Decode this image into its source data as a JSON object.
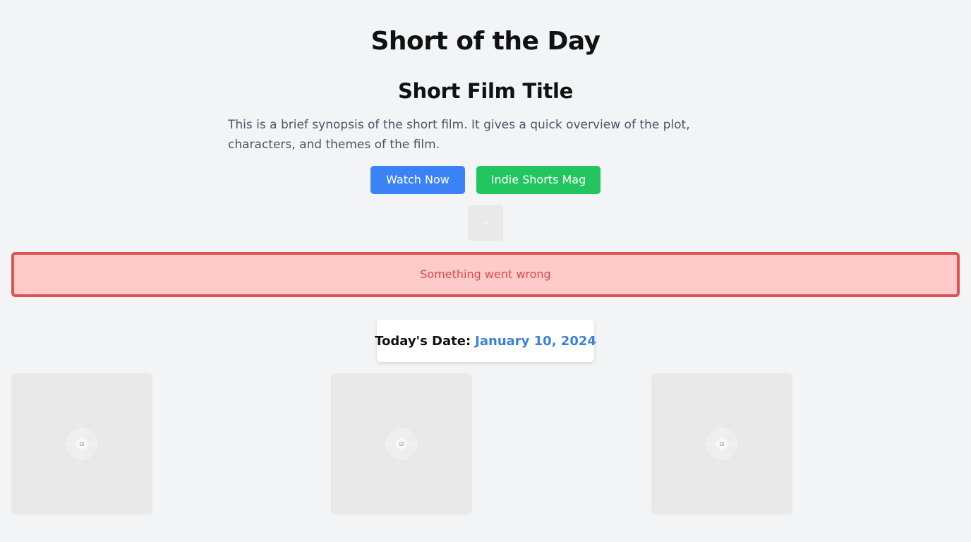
{
  "header": {
    "site_title": "Short of the Day"
  },
  "film": {
    "title": "Short Film Title",
    "synopsis": "This is a brief synopsis of the short film. It gives a quick overview of the plot, characters, and themes of the film."
  },
  "actions": {
    "watch_label": "Watch Now",
    "mag_label": "Indie Shorts Mag"
  },
  "error": {
    "message": "Something went wrong"
  },
  "date": {
    "label": "Today's Date:",
    "value": "January 10, 2024"
  },
  "colors": {
    "background": "#f3f4f6",
    "watch_button": "#3b82f6",
    "mag_button": "#22c55e",
    "error_border": "#e05252",
    "error_background": "#fecaca",
    "error_text": "#dc4a4a",
    "date_value": "#3b82d6"
  },
  "icons": {
    "film_thumbnail": "image-placeholder-icon",
    "grid_placeholder": "image-placeholder-icon"
  }
}
